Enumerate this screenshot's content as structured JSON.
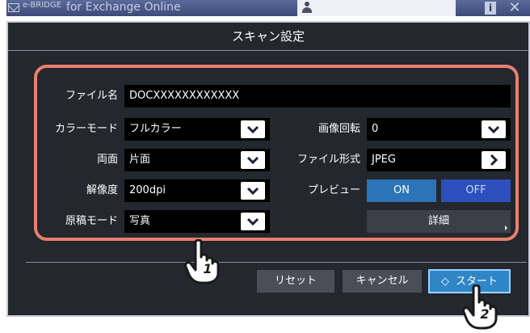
{
  "app": {
    "title_sub": "e-BRIDGE",
    "title_main": "for Exchange Online"
  },
  "dialog": {
    "title": "スキャン設定"
  },
  "form": {
    "filename_label": "ファイル名",
    "filename_value": "DOCXXXXXXXXXXXX",
    "color_mode_label": "カラーモード",
    "color_mode_value": "フルカラー",
    "rotation_label": "画像回転",
    "rotation_value": "0",
    "duplex_label": "両面",
    "duplex_value": "片面",
    "file_format_label": "ファイル形式",
    "file_format_value": "JPEG",
    "resolution_label": "解像度",
    "resolution_value": "200dpi",
    "preview_label": "プレビュー",
    "preview_on": "ON",
    "preview_off": "OFF",
    "original_mode_label": "原稿モード",
    "original_mode_value": "写真",
    "detail_label": "詳細"
  },
  "actions": {
    "reset": "リセット",
    "cancel": "キャンセル",
    "start": "スタート",
    "start_icon": "◇"
  },
  "callouts": {
    "step1": "1",
    "step2": "2"
  },
  "colors": {
    "frame_highlight": "#e97f6e",
    "dialog_bg": "#24272d",
    "start_button": "#2f86c7",
    "preview_off_selected": "#2d4fbd"
  },
  "icons": [
    "mail-icon",
    "user-icon",
    "info-icon",
    "close-icon",
    "chevron-down-icon",
    "chevron-right-icon",
    "pointing-hand-icon"
  ]
}
